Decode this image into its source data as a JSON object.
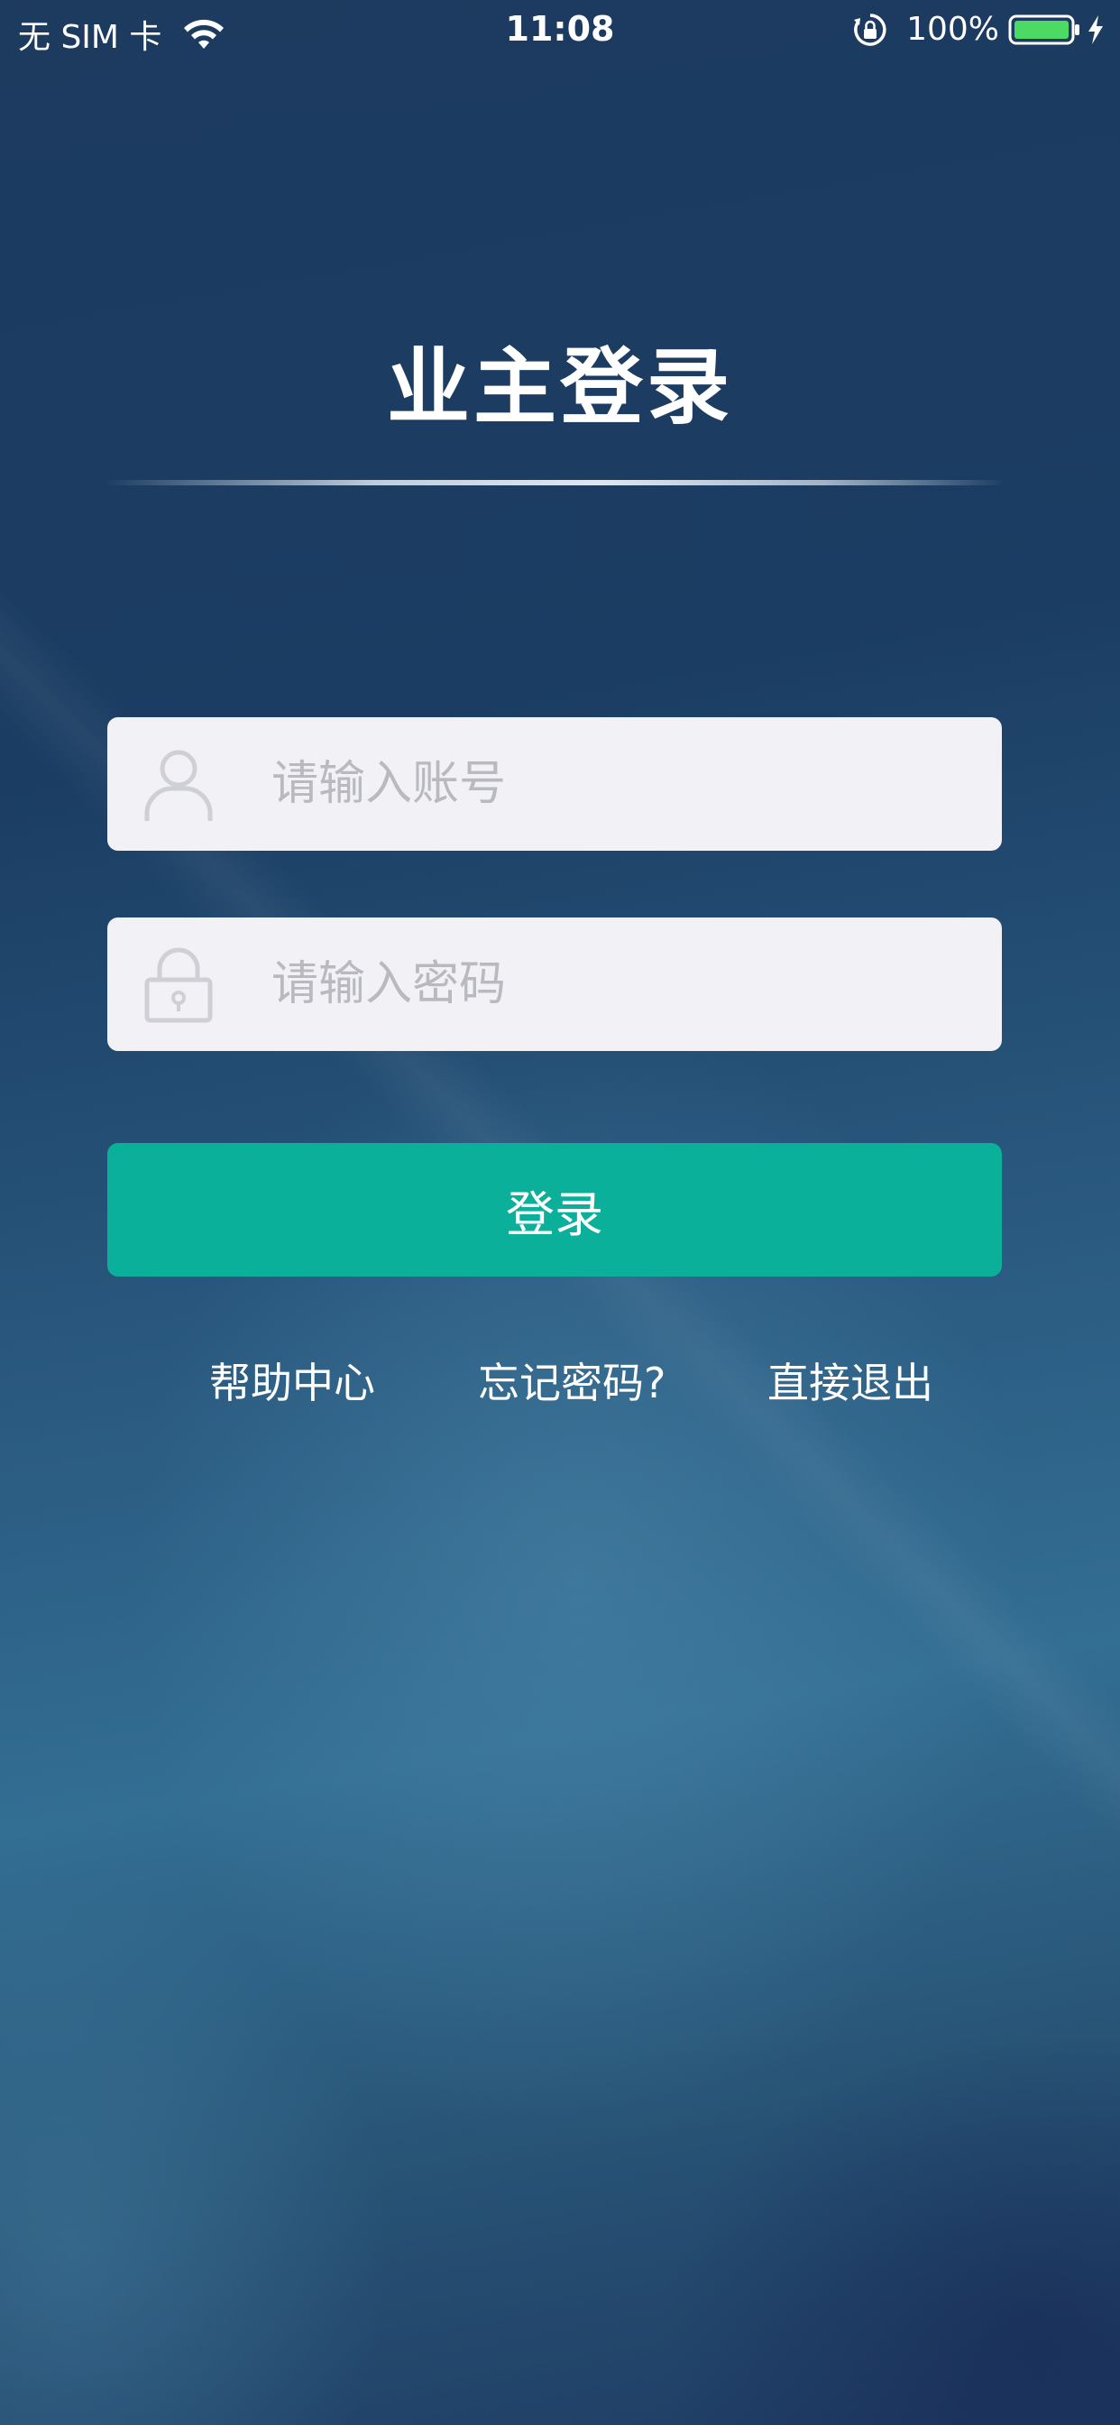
{
  "status_bar": {
    "carrier": "无 SIM 卡",
    "time": "11:08",
    "battery": "100%",
    "icons": [
      "wifi-icon",
      "rotation-lock-icon",
      "battery-icon",
      "charging-icon"
    ],
    "battery_color": "#4cd964"
  },
  "title": "业主登录",
  "account_field": {
    "icon": "user-icon",
    "placeholder": "请输入账号",
    "value": ""
  },
  "password_field": {
    "icon": "lock-icon",
    "placeholder": "请输入密码",
    "value": ""
  },
  "login_button": {
    "label": "登录",
    "color": "#0bb09a"
  },
  "links": {
    "help": "帮助中心",
    "forgot": "忘记密码?",
    "exit": "直接退出"
  }
}
